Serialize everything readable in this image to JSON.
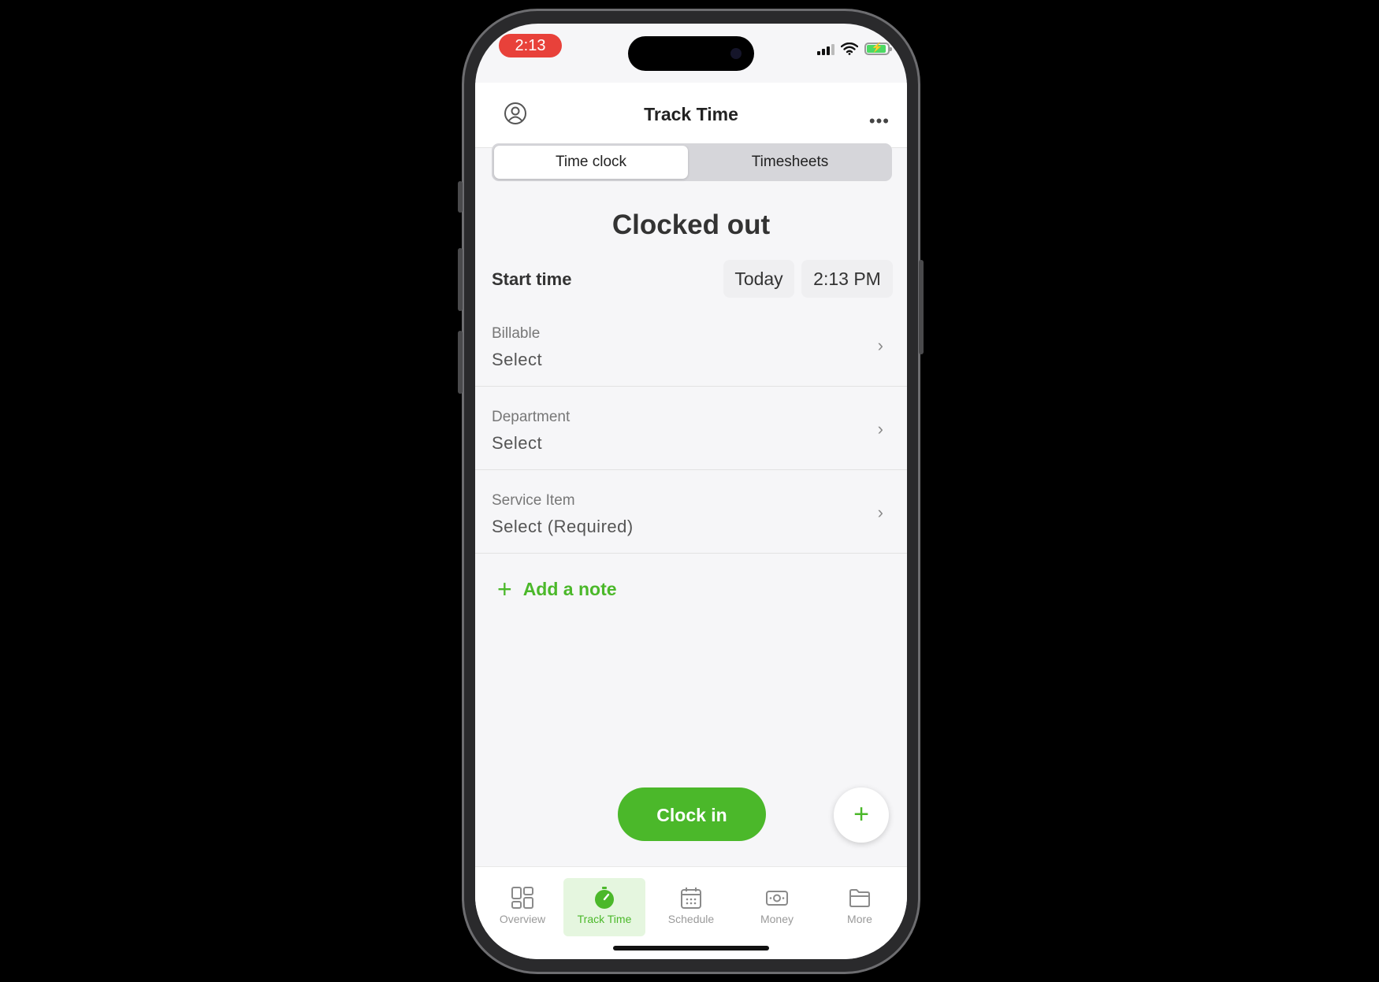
{
  "status_bar": {
    "time": "2:13"
  },
  "header": {
    "title": "Track Time"
  },
  "segments": [
    {
      "label": "Time clock",
      "active": true
    },
    {
      "label": "Timesheets",
      "active": false
    }
  ],
  "clock": {
    "status": "Clocked out",
    "start_label": "Start time",
    "start_date": "Today",
    "start_time": "2:13 PM"
  },
  "fields": [
    {
      "label": "Billable",
      "value": "Select"
    },
    {
      "label": "Department",
      "value": "Select"
    },
    {
      "label": "Service Item",
      "value": "Select (Required)"
    }
  ],
  "add_note": "Add a note",
  "actions": {
    "clock_in": "Clock in",
    "fab": "+"
  },
  "tabs": [
    {
      "label": "Overview",
      "icon": "grid-icon"
    },
    {
      "label": "Track Time",
      "icon": "stopwatch-icon",
      "active": true
    },
    {
      "label": "Schedule",
      "icon": "calendar-icon"
    },
    {
      "label": "Money",
      "icon": "money-icon"
    },
    {
      "label": "More",
      "icon": "folder-icon"
    }
  ],
  "colors": {
    "accent": "#4bb82a",
    "status_time_bg": "#e8413a"
  }
}
